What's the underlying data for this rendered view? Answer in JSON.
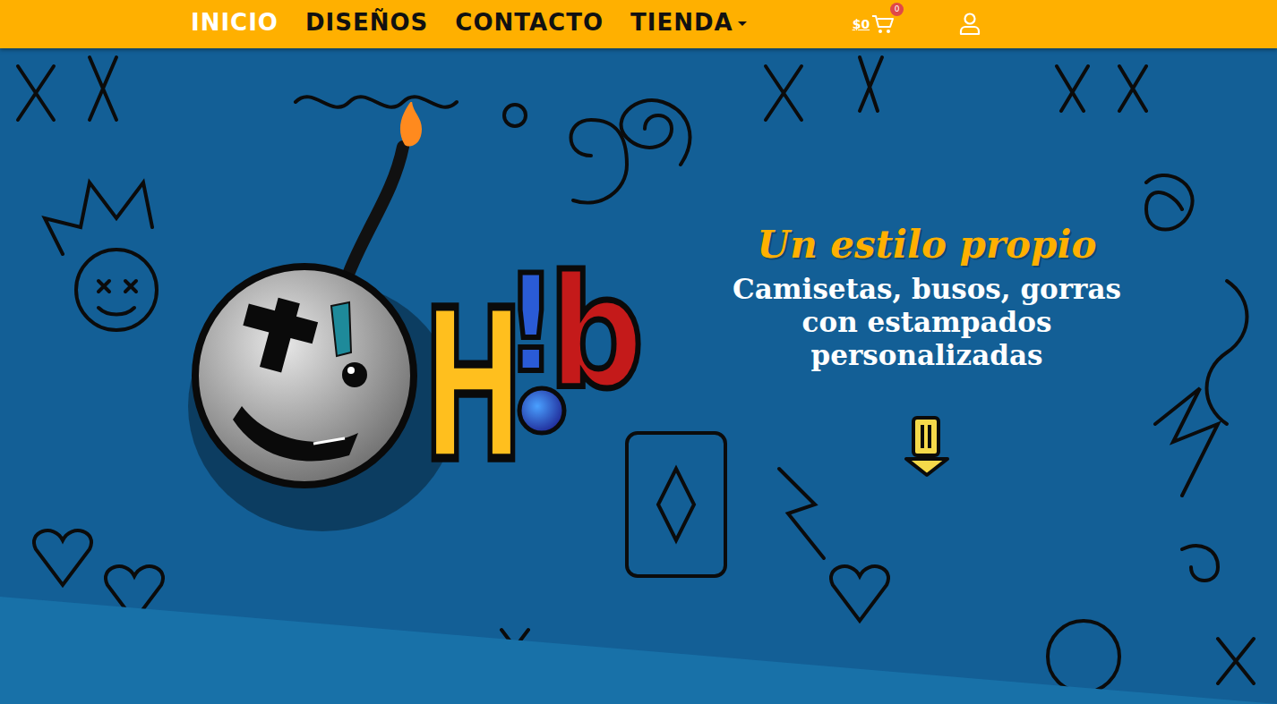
{
  "navbar": {
    "items": [
      {
        "label": "INICIO",
        "selected": true,
        "has_menu": false
      },
      {
        "label": "DISEÑOS",
        "selected": false,
        "has_menu": false
      },
      {
        "label": "CONTACTO",
        "selected": false,
        "has_menu": false
      },
      {
        "label": "TIENDA",
        "selected": false,
        "has_menu": true
      }
    ],
    "cart": {
      "total": "$0",
      "count": "0"
    }
  },
  "hero": {
    "logo": {
      "letters": [
        "H",
        "!",
        "b"
      ]
    },
    "title": "Un estilo propio",
    "subtitle_lines": [
      "Camisetas, busos, gorras",
      "con estampados",
      "personalizadas"
    ]
  }
}
